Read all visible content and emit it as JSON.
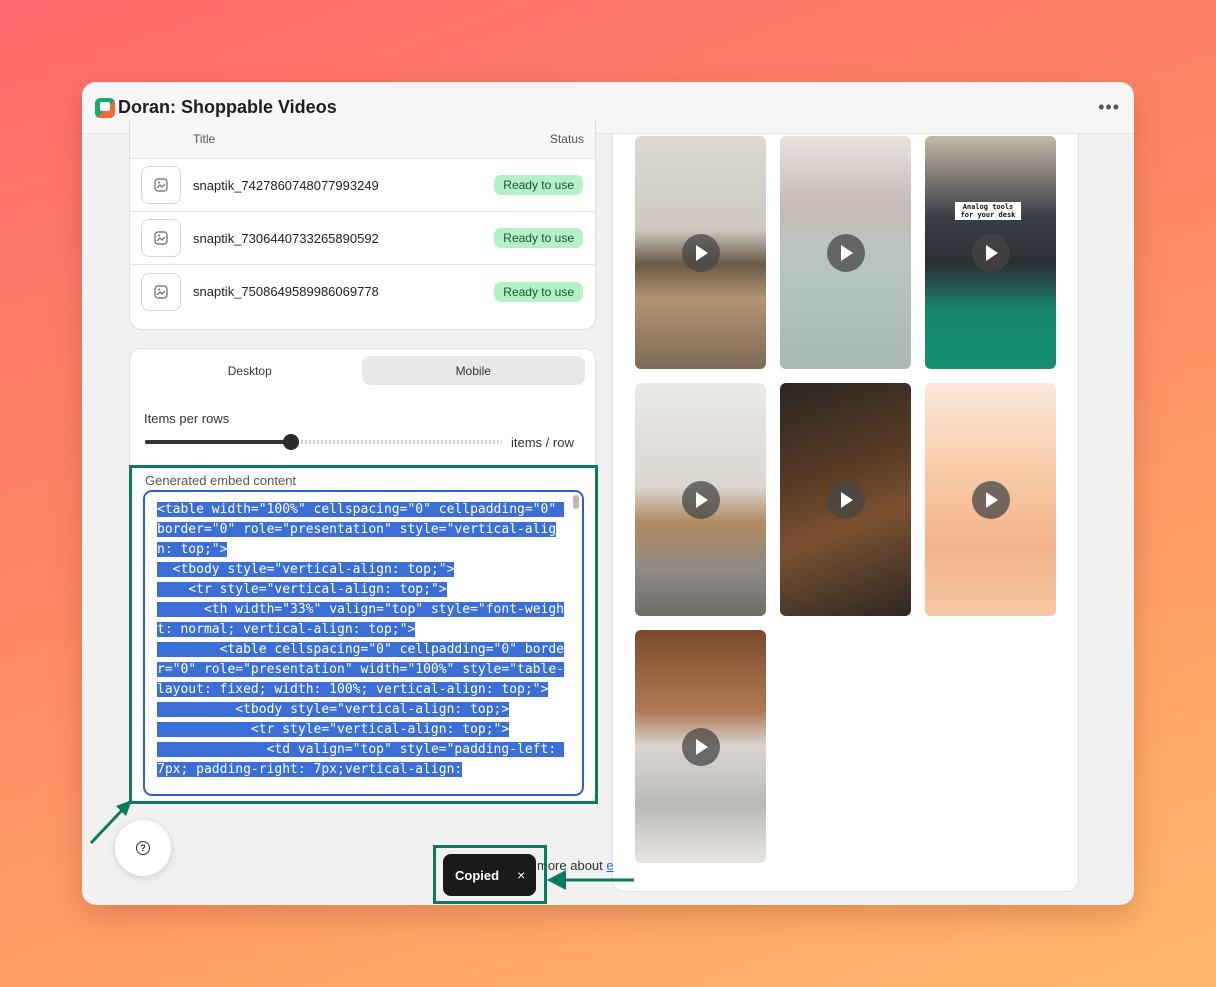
{
  "app": {
    "title": "Doran: Shoppable Videos",
    "more_icon": "•••"
  },
  "colors": {
    "accent_frame": "#0d7a5f",
    "selection": "#3b6fd7",
    "badge_bg": "#b6f0c6",
    "badge_text": "#0e5a2b"
  },
  "table": {
    "columns": {
      "title": "Title",
      "status": "Status"
    },
    "rows": [
      {
        "title": "snaptik_7427860748077993249",
        "status": "Ready to use"
      },
      {
        "title": "snaptik_7306440733265890592",
        "status": "Ready to use"
      },
      {
        "title": "snaptik_7508649589986069778",
        "status": "Ready to use"
      }
    ]
  },
  "settings": {
    "tabs": {
      "desktop": "Desktop",
      "mobile": "Mobile"
    },
    "active_tab": "Mobile",
    "items_per_row_label": "Items per rows",
    "slider_suffix": "items / row",
    "slider_fraction": 0.41,
    "embed_label": "Generated embed content",
    "embed_code": "<table width=\"100%\" cellspacing=\"0\" cellpadding=\"0\" border=\"0\" role=\"presentation\" style=\"vertical-align: top;\">\n  <tbody style=\"vertical-align: top;\">\n    <tr style=\"vertical-align: top;\">\n      <th width=\"33%\" valign=\"top\" style=\"font-weight: normal; vertical-align: top;\">\n        <table cellspacing=\"0\" cellpadding=\"0\" border=\"0\" role=\"presentation\" width=\"100%\" style=\"table-layout: fixed; width: 100%; vertical-align: top;\">\n          <tbody style=\"vertical-align: top;>\n            <tr style=\"vertical-align: top;\">\n              <td valign=\"top\" style=\"padding-left: 7px; padding-right: 7px;vertical-align:"
  },
  "videos": [
    {
      "caption": ""
    },
    {
      "caption": ""
    },
    {
      "caption": "Analog tools for your desk"
    },
    {
      "caption": ""
    },
    {
      "caption": ""
    },
    {
      "caption": ""
    },
    {
      "caption": ""
    }
  ],
  "footer": {
    "learn_more": "more about",
    "learn_link": "e"
  },
  "toast": {
    "message": "Copied",
    "close": "×"
  }
}
